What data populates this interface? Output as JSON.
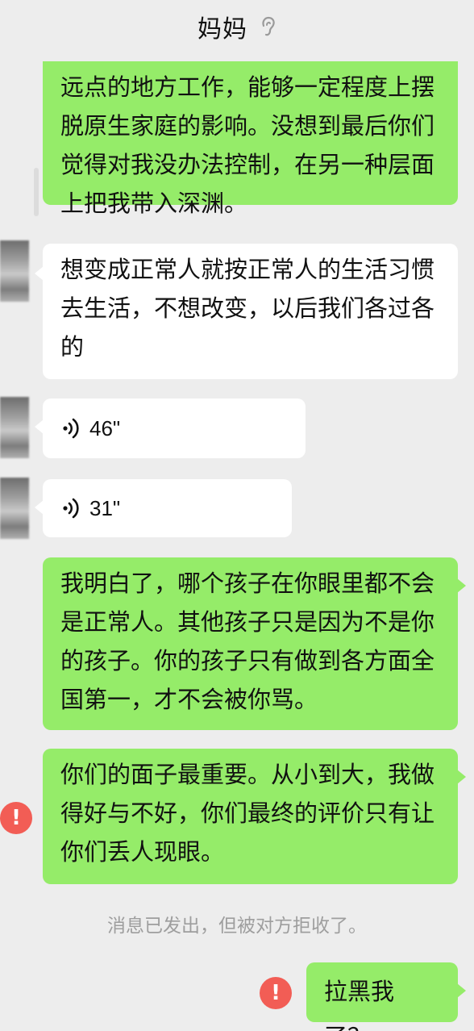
{
  "header": {
    "title": "妈妈",
    "ear_icon": "ear-icon"
  },
  "colors": {
    "background": "#ededed",
    "sent_bubble": "#95ec69",
    "received_bubble": "#ffffff",
    "error": "#f25d55",
    "system_text": "#9e9e9e"
  },
  "messages": [
    {
      "side": "sent",
      "type": "text",
      "text": "远点的地方工作，能够一定程度上摆脱原生家庭的影响。没想到最后你们觉得对我没办法控制，在另一种层面上把我带入深渊。"
    },
    {
      "side": "received",
      "type": "text",
      "text": "想变成正常人就按正常人的生活习惯去生活，不想改变，以后我们各过各的"
    },
    {
      "side": "received",
      "type": "voice",
      "duration": "46\""
    },
    {
      "side": "received",
      "type": "voice",
      "duration": "31\""
    },
    {
      "side": "sent",
      "type": "text",
      "text": "我明白了，哪个孩子在你眼里都不会是正常人。其他孩子只是因为不是你的孩子。你的孩子只有做到各方面全国第一，才不会被你骂。"
    },
    {
      "side": "sent",
      "type": "text",
      "failed": true,
      "error_symbol": "!",
      "text": "你们的面子最重要。从小到大，我做得好与不好，你们最终的评价只有让你们丢人现眼。"
    },
    {
      "side": "sent",
      "type": "text",
      "failed": true,
      "error_symbol": "!",
      "text": "拉黑我了？"
    }
  ],
  "system_note": "消息已发出，但被对方拒收了。"
}
